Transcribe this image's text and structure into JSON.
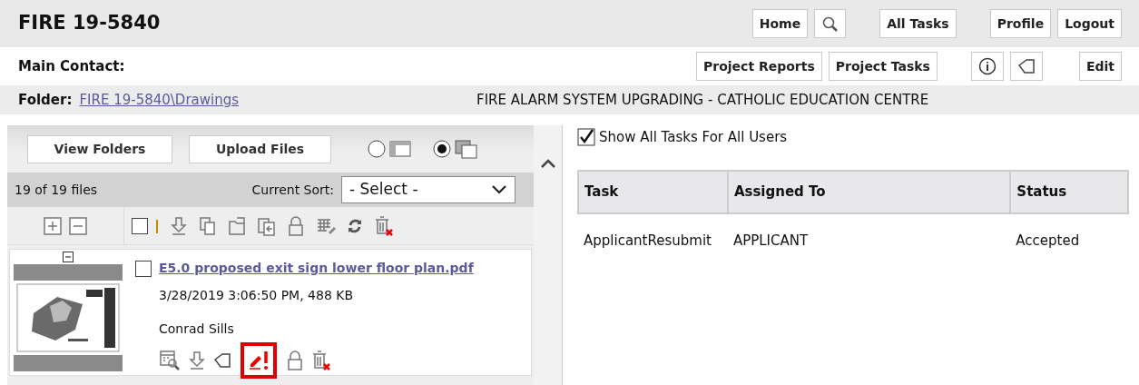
{
  "header": {
    "title": "FIRE 19-5840",
    "buttons": [
      {
        "kind": "text",
        "label": "Home"
      },
      {
        "kind": "search"
      },
      {
        "kind": "text",
        "label": "All Tasks"
      },
      {
        "kind": "text",
        "label": "Profile"
      },
      {
        "kind": "text",
        "label": "Logout"
      }
    ]
  },
  "contact_bar": {
    "label": "Main Contact:",
    "buttons": [
      {
        "kind": "text",
        "label": "Project Reports"
      },
      {
        "kind": "text",
        "label": "Project Tasks"
      },
      {
        "kind": "info"
      },
      {
        "kind": "tag"
      },
      {
        "kind": "text",
        "label": "Edit"
      }
    ]
  },
  "folder_bar": {
    "label": "Folder:",
    "path": "FIRE 19-5840\\Drawings",
    "project": "FIRE ALARM SYSTEM UPGRADING - CATHOLIC EDUCATION CENTRE"
  },
  "file_panel": {
    "buttons": [
      "View Folders",
      "Upload Files"
    ],
    "view_options": [
      {
        "kind": "list",
        "selected": false
      },
      {
        "kind": "tiles",
        "selected": true
      }
    ],
    "file_count": "19 of 19 files",
    "sort_label": "Current Sort:",
    "sort_value": "- Select -",
    "toolbar": {
      "select_all_checked": false,
      "tools": [
        {
          "kind": "download"
        },
        {
          "kind": "copy"
        },
        {
          "kind": "move"
        },
        {
          "kind": "merge"
        },
        {
          "kind": "lock"
        },
        {
          "kind": "grid-edit"
        },
        {
          "kind": "refresh"
        },
        {
          "kind": "delete"
        }
      ]
    },
    "files": [
      {
        "checked": false,
        "name": "E5.0 proposed exit sign lower floor plan.pdf",
        "date_size": "3/28/2019 3:06:50 PM, 488 KB",
        "author": "Conrad Sills",
        "actions": [
          {
            "kind": "preview",
            "highlighted": false
          },
          {
            "kind": "download",
            "highlighted": false
          },
          {
            "kind": "tag",
            "highlighted": false
          },
          {
            "kind": "markup-alert",
            "highlighted": true
          },
          {
            "kind": "lock",
            "highlighted": false
          },
          {
            "kind": "delete",
            "highlighted": false
          }
        ]
      }
    ]
  },
  "tasks": {
    "show_all_label": "Show All Tasks For All Users",
    "show_all_checked": true,
    "table": {
      "columns": [
        "Task",
        "Assigned To",
        "Status"
      ],
      "rows": [
        [
          "ApplicantResubmit",
          "APPLICANT",
          "Accepted"
        ]
      ]
    }
  }
}
